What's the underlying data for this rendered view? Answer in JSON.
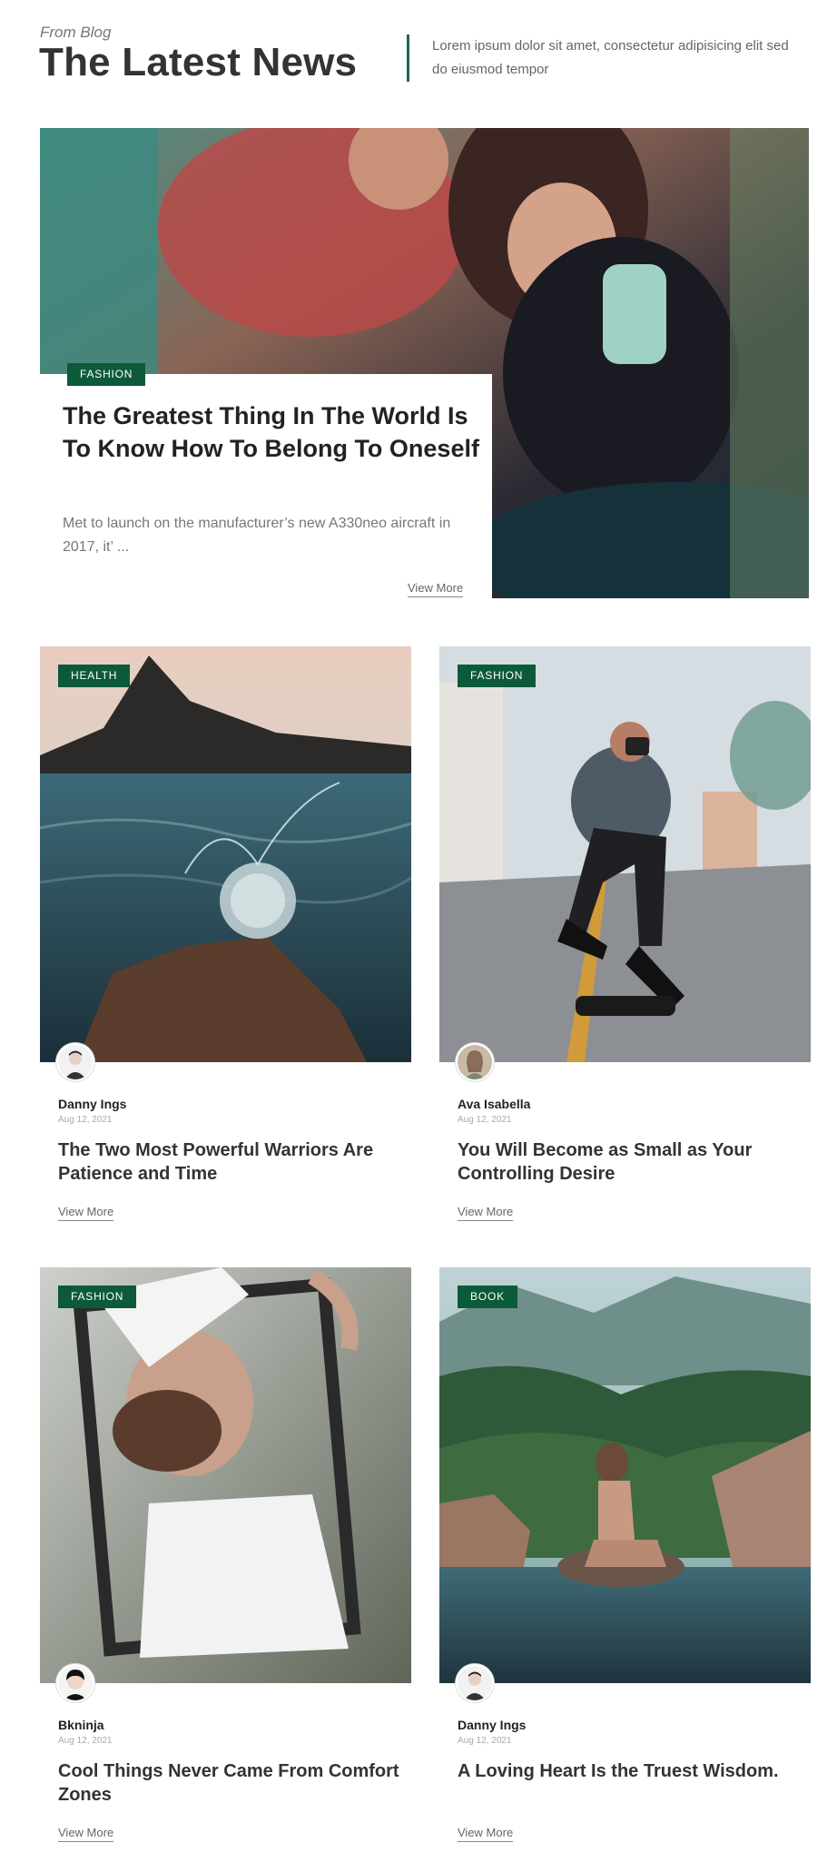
{
  "header": {
    "kicker": "From Blog",
    "title": "The Latest News",
    "description": "Lorem ipsum dolor sit amet, consectetur adipisicing elit sed do eiusmod tempor"
  },
  "featured": {
    "category": "FASHION",
    "title": "The Greatest Thing In The World Is To Know How To Belong To Oneself",
    "excerpt": "Met to launch on the manufacturer’s new A330neo aircraft in 2017, it’ ...",
    "link_label": "View More"
  },
  "posts": [
    {
      "category": "HEALTH",
      "author": "Danny Ings",
      "date": "Aug 12, 2021",
      "title": "The Two Most Powerful Warriors Are Patience and Time",
      "link_label": "View More"
    },
    {
      "category": "FASHION",
      "author": "Ava Isabella",
      "date": "Aug 12, 2021",
      "title": "You Will Become as Small as Your Controlling Desire",
      "link_label": "View More"
    },
    {
      "category": "FASHION",
      "author": "Bkninja",
      "date": "Aug 12, 2021",
      "title": "Cool Things Never Came From Comfort Zones",
      "link_label": "View More"
    },
    {
      "category": "BOOK",
      "author": "Danny Ings",
      "date": "Aug 12, 2021",
      "title": "A Loving Heart Is the Truest Wisdom.",
      "link_label": "View More"
    }
  ],
  "colors": {
    "accent": "#0d5a3b",
    "divider": "#1b6b4b",
    "title": "#333333",
    "muted": "#777777"
  }
}
